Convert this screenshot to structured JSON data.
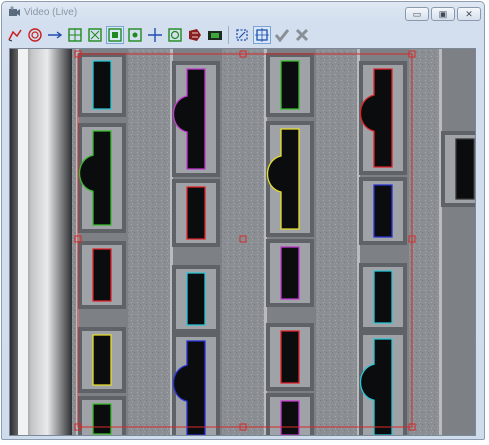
{
  "window": {
    "title": "Video (Live)"
  },
  "titlebar_buttons": [
    "minimize",
    "restore",
    "close"
  ],
  "toolbar": {
    "tools": [
      {
        "name": "polyline-tool-icon",
        "active": false
      },
      {
        "name": "circle-target-tool-icon",
        "active": false
      },
      {
        "name": "arrow-measure-tool-icon",
        "active": false
      },
      {
        "name": "box-edges-tool-icon",
        "active": false
      },
      {
        "name": "box-corners-tool-icon",
        "active": false
      },
      {
        "name": "box-focus-tool-icon",
        "active": true
      },
      {
        "name": "center-box-tool-icon",
        "active": false
      },
      {
        "name": "crosshair-tool-icon",
        "active": false
      },
      {
        "name": "circle-focus-tool-icon",
        "active": false
      },
      {
        "name": "light-tool-icon",
        "active": false
      },
      {
        "name": "film-tool-icon",
        "active": false
      },
      {
        "name": "crop-tool-icon",
        "active": false
      },
      {
        "name": "select-region-tool-icon",
        "active": true
      },
      {
        "name": "accept-icon",
        "active": false
      },
      {
        "name": "reject-icon",
        "active": false
      }
    ]
  },
  "colors": {
    "roi": "#d42a2a",
    "contour_cyan": "#29c6d6",
    "contour_magenta": "#c23ad0",
    "contour_green": "#3bbb2e",
    "contour_yellow": "#e6df2a",
    "contour_red": "#e0222a",
    "contour_blue": "#2a32d8"
  }
}
